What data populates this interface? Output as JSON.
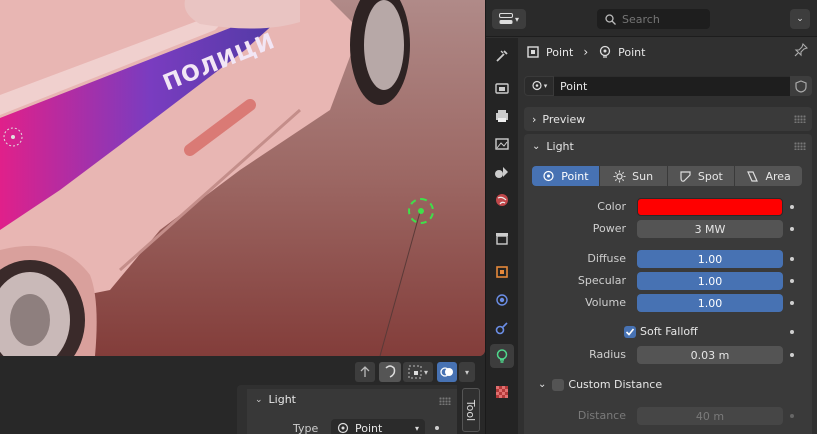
{
  "header": {
    "search_placeholder": "Search"
  },
  "breadcrumb": {
    "object": "Point",
    "data": "Point"
  },
  "datablock": {
    "name": "Point"
  },
  "panels": {
    "preview": "Preview",
    "light": "Light"
  },
  "light_types": [
    "Point",
    "Sun",
    "Spot",
    "Area"
  ],
  "light_props": {
    "color_label": "Color",
    "color_value": "#ff0000",
    "power_label": "Power",
    "power_value": "3 MW",
    "diffuse_label": "Diffuse",
    "diffuse_value": "1.00",
    "specular_label": "Specular",
    "specular_value": "1.00",
    "volume_label": "Volume",
    "volume_value": "1.00",
    "soft_falloff_label": "Soft Falloff",
    "soft_falloff_checked": true,
    "radius_label": "Radius",
    "radius_value": "0.03 m",
    "custom_distance_label": "Custom Distance",
    "custom_distance_checked": false,
    "distance_label": "Distance",
    "distance_value": "40 m"
  },
  "viewport": {
    "car_text": "ПОЛИЦИ",
    "tool_panel_title": "Light",
    "tool_panel_type_label": "Type",
    "tool_panel_type_value": "Point",
    "tool_tab_label": "Tool"
  }
}
